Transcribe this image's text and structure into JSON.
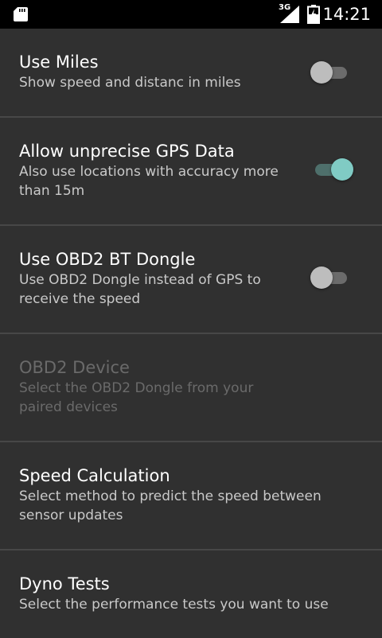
{
  "status_bar": {
    "network": "3G",
    "time": "14:21",
    "icons": [
      "sd-card-icon",
      "signal-icon",
      "battery-icon"
    ]
  },
  "colors": {
    "accent": "#80cbc4",
    "background": "#303030",
    "divider": "#474747"
  },
  "settings": [
    {
      "title": "Use Miles",
      "summary": "Show speed and distanc in miles",
      "switch": "off"
    },
    {
      "title": "Allow unprecise GPS Data",
      "summary": "Also use locations with accuracy more than 15m",
      "switch": "on"
    },
    {
      "title": "Use OBD2 BT Dongle",
      "summary": "Use OBD2 Dongle instead of GPS to receive the speed",
      "switch": "off"
    },
    {
      "title": "OBD2 Device",
      "summary": "Select the OBD2 Dongle from your paired devices",
      "enabled": false
    },
    {
      "title": "Speed Calculation",
      "summary": "Select method to predict the speed between sensor updates"
    },
    {
      "title": "Dyno Tests",
      "summary": "Select the performance tests you want to use"
    }
  ]
}
